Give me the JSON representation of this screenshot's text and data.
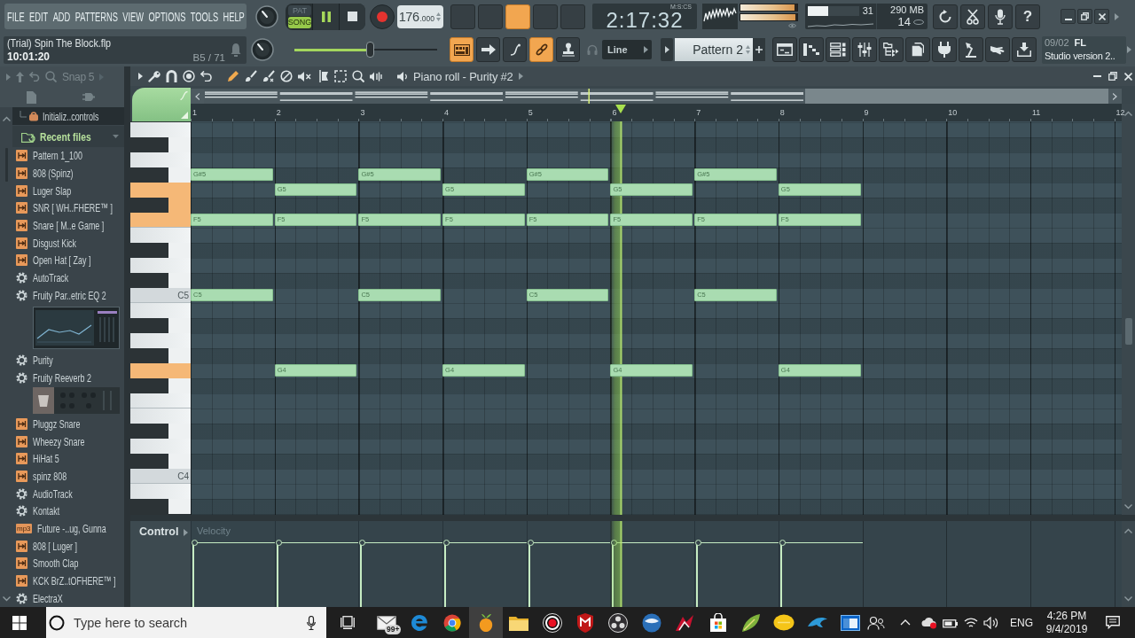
{
  "toolbar": {
    "menu": [
      "FILE",
      "EDIT",
      "ADD",
      "PATTERNS",
      "VIEW",
      "OPTIONS",
      "TOOLS",
      "HELP"
    ],
    "mode": [
      {
        "label": "PAT",
        "selected": false
      },
      {
        "label": "SONG",
        "selected": true
      }
    ],
    "transport": {
      "playing": true
    },
    "tempo": {
      "whole": "176",
      "fraction": ".000"
    },
    "pattern_buttons": [
      {
        "selected": false
      },
      {
        "selected": false
      },
      {
        "selected": true
      },
      {
        "selected": false
      },
      {
        "selected": false
      }
    ],
    "time": {
      "format": "M:S:CS",
      "value": "2:17:32"
    },
    "peak_meters": [
      {
        "level": 0.96
      },
      {
        "level": 0.97
      }
    ],
    "cpu": {
      "level": 0.4,
      "reading": "31",
      "memory": "290 MB",
      "polyphony": "14"
    },
    "help": "?",
    "hint": {
      "title": "(Trial) Spin The Block.flp",
      "time": "10:01:20",
      "position": "B5 / 71"
    },
    "pitch": {
      "level": 0.53
    },
    "tools": [
      {
        "kind": "keyboard",
        "selected": true
      },
      {
        "kind": "arrow",
        "selected": false
      },
      {
        "kind": "curve",
        "selected": false
      },
      {
        "kind": "link",
        "selected": true
      },
      {
        "kind": "stamp",
        "selected": false
      }
    ],
    "snap": "Line",
    "pattern": "Pattern 2",
    "news": {
      "date": "09/02",
      "title": "FL",
      "text": "Studio version 2.."
    }
  },
  "browser": {
    "snap": "Snap 5",
    "items": [
      {
        "kind": "preset",
        "label": "Initializ..controls",
        "selected": true
      },
      {
        "kind": "folder",
        "label": "Recent files",
        "selected": false
      },
      {
        "kind": "sample",
        "label": "Pattern 1_100",
        "selected": false
      },
      {
        "kind": "sample",
        "label": "808 (Spinz)",
        "selected": false
      },
      {
        "kind": "sample",
        "label": "Luger Slap",
        "selected": false
      },
      {
        "kind": "sample",
        "label": "SNR [ WH..FHERE™ ]",
        "selected": false
      },
      {
        "kind": "sample",
        "label": "Snare [ M..e Game ]",
        "selected": false
      },
      {
        "kind": "sample",
        "label": "Disgust Kick",
        "selected": false
      },
      {
        "kind": "sample",
        "label": "Open Hat [ Zay ]",
        "selected": false
      },
      {
        "kind": "plugin",
        "label": "AutoTrack",
        "selected": false
      },
      {
        "kind": "plugin",
        "label": "Fruity Par..etric EQ 2",
        "selected": false,
        "preview": {
          "kind": "graph"
        }
      },
      {
        "kind": "plugin",
        "label": "Purity",
        "selected": false
      },
      {
        "kind": "plugin",
        "label": "Fruity Reeverb 2",
        "selected": false,
        "preview": {
          "kind": "panel"
        }
      },
      {
        "kind": "sample",
        "label": "Pluggz Snare",
        "selected": false
      },
      {
        "kind": "sample",
        "label": "Wheezy Snare",
        "selected": false
      },
      {
        "kind": "sample",
        "label": "HiHat 5",
        "selected": false
      },
      {
        "kind": "sample",
        "label": "spinz 808",
        "selected": false
      },
      {
        "kind": "plugin",
        "label": "AudioTrack",
        "selected": false
      },
      {
        "kind": "plugin",
        "label": "Kontakt",
        "selected": false
      },
      {
        "kind": "audio",
        "label": "Future -..ug, Gunna",
        "badge": "mp3",
        "selected": false
      },
      {
        "kind": "sample",
        "label": "808 [ Luger ]",
        "selected": false
      },
      {
        "kind": "sample",
        "label": "Smooth Clap",
        "selected": false
      },
      {
        "kind": "sample",
        "label": "KCK BrZ..tOFHERE™ ]",
        "selected": false
      },
      {
        "kind": "plugin",
        "label": "ElectraX",
        "selected": false
      }
    ]
  },
  "piano_roll": {
    "title": "Piano roll - Purity #2",
    "ruler": [
      "1",
      "2",
      "3",
      "4",
      "5",
      "6",
      "7",
      "8",
      "9",
      "10",
      "11",
      "12"
    ],
    "playhead": {
      "level": 0.464
    },
    "rows": [
      {
        "kind": "white",
        "highlighted": false
      },
      {
        "kind": "black",
        "highlighted": false
      },
      {
        "kind": "white",
        "highlighted": false
      },
      {
        "kind": "black",
        "highlighted": false,
        "cells": [
          {
            "kind": "note",
            "label": "G#5"
          },
          {
            "kind": "rest"
          },
          {
            "kind": "note",
            "label": "G#5"
          },
          {
            "kind": "rest"
          },
          {
            "kind": "note",
            "label": "G#5"
          },
          {
            "kind": "rest"
          },
          {
            "kind": "note",
            "label": "G#5"
          },
          {
            "kind": "rest"
          }
        ]
      },
      {
        "kind": "white",
        "highlighted": true,
        "cells": [
          {
            "kind": "rest"
          },
          {
            "kind": "note",
            "label": "G5"
          },
          {
            "kind": "rest"
          },
          {
            "kind": "note",
            "label": "G5"
          },
          {
            "kind": "rest"
          },
          {
            "kind": "note",
            "label": "G5"
          },
          {
            "kind": "rest"
          },
          {
            "kind": "note",
            "label": "G5"
          }
        ]
      },
      {
        "kind": "black",
        "highlighted": true
      },
      {
        "kind": "white",
        "highlighted": true,
        "cells": [
          {
            "kind": "note",
            "label": "F5"
          },
          {
            "kind": "note",
            "label": "F5"
          },
          {
            "kind": "note",
            "label": "F5"
          },
          {
            "kind": "note",
            "label": "F5"
          },
          {
            "kind": "note",
            "label": "F5"
          },
          {
            "kind": "note",
            "label": "F5"
          },
          {
            "kind": "note",
            "label": "F5"
          },
          {
            "kind": "note",
            "label": "F5"
          }
        ]
      },
      {
        "kind": "white",
        "highlighted": false
      },
      {
        "kind": "black",
        "highlighted": false
      },
      {
        "kind": "white",
        "highlighted": false
      },
      {
        "kind": "black",
        "highlighted": false
      },
      {
        "kind": "white",
        "highlighted": false,
        "label": "C5",
        "cells": [
          {
            "kind": "note",
            "label": "C5"
          },
          {
            "kind": "rest"
          },
          {
            "kind": "note",
            "label": "C5"
          },
          {
            "kind": "rest"
          },
          {
            "kind": "note",
            "label": "C5"
          },
          {
            "kind": "rest"
          },
          {
            "kind": "note",
            "label": "C5"
          },
          {
            "kind": "rest"
          }
        ]
      },
      {
        "kind": "white",
        "highlighted": false
      },
      {
        "kind": "black",
        "highlighted": false
      },
      {
        "kind": "white",
        "highlighted": false
      },
      {
        "kind": "black",
        "highlighted": false
      },
      {
        "kind": "white",
        "highlighted": true,
        "cells": [
          {
            "kind": "rest"
          },
          {
            "kind": "note",
            "label": "G4"
          },
          {
            "kind": "rest"
          },
          {
            "kind": "note",
            "label": "G4"
          },
          {
            "kind": "rest"
          },
          {
            "kind": "note",
            "label": "G4"
          },
          {
            "kind": "rest"
          },
          {
            "kind": "note",
            "label": "G4"
          }
        ]
      },
      {
        "kind": "black",
        "highlighted": false
      },
      {
        "kind": "white",
        "highlighted": false
      },
      {
        "kind": "white",
        "highlighted": false
      },
      {
        "kind": "black",
        "highlighted": false
      },
      {
        "kind": "white",
        "highlighted": false
      },
      {
        "kind": "black",
        "highlighted": false
      },
      {
        "kind": "white",
        "highlighted": false,
        "label": "C4"
      },
      {
        "kind": "white",
        "highlighted": false
      },
      {
        "kind": "black",
        "highlighted": false
      }
    ],
    "control": {
      "label": "Control",
      "parameter": "Velocity",
      "velocities": [
        {
          "level": 0.78
        },
        {
          "level": 0.78
        },
        {
          "level": 0.78
        },
        {
          "level": 0.78
        },
        {
          "level": 0.78
        },
        {
          "level": 0.78
        },
        {
          "level": 0.78
        },
        {
          "level": 0.78
        }
      ]
    }
  },
  "taskbar": {
    "search": {
      "placeholder": "Type here to search"
    },
    "apps": [
      {
        "kind": "taskview",
        "selected": false
      },
      {
        "kind": "mail",
        "badge": "99+",
        "selected": false
      },
      {
        "kind": "edge",
        "selected": false
      },
      {
        "kind": "chrome",
        "selected": false
      },
      {
        "kind": "fruit",
        "selected": true
      },
      {
        "kind": "folder",
        "selected": false
      },
      {
        "kind": "record",
        "selected": false
      },
      {
        "kind": "shield",
        "selected": false
      },
      {
        "kind": "obs",
        "selected": false
      },
      {
        "kind": "sphere",
        "selected": false
      },
      {
        "kind": "splash",
        "selected": false
      },
      {
        "kind": "store",
        "selected": false
      },
      {
        "kind": "leaf",
        "selected": false
      },
      {
        "kind": "lemon",
        "selected": false
      },
      {
        "kind": "dolphin",
        "selected": false
      },
      {
        "kind": "window",
        "selected": false
      }
    ],
    "tray": {
      "language": "ENG",
      "time": "4:26 PM",
      "date": "9/4/2019"
    }
  }
}
